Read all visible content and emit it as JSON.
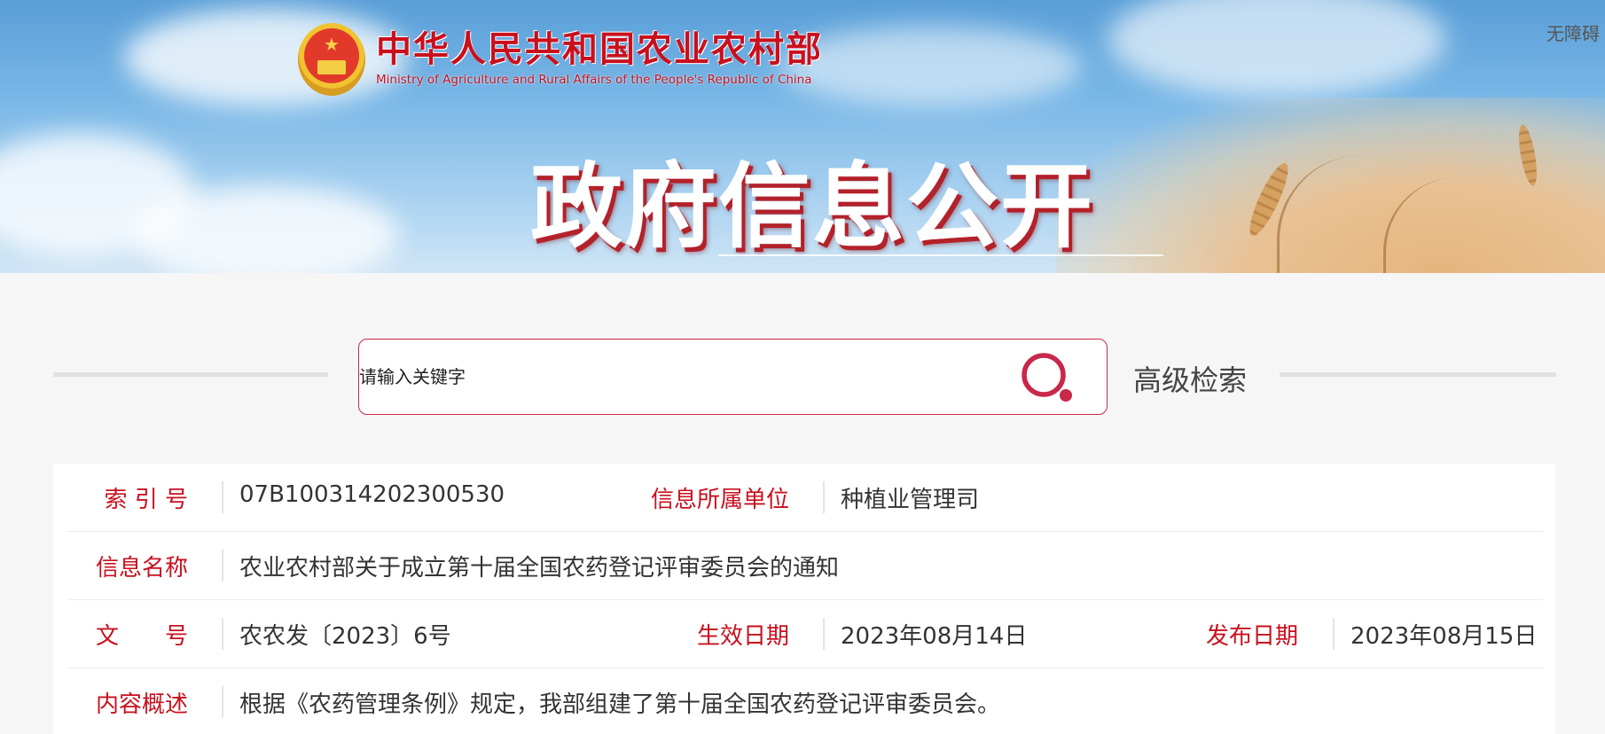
{
  "header": {
    "accessibility_label": "无障碍",
    "logo_cn": "中华人民共和国农业农村部",
    "logo_en": "Ministry of Agriculture and Rural Affairs of the People's Republic of China",
    "banner_title": "政府信息公开"
  },
  "search": {
    "placeholder": "请输入关键字",
    "advanced_label": "高级检索"
  },
  "info": {
    "index_label": "索 引 号",
    "index_value": "07B100314202300530",
    "unit_label": "信息所属单位",
    "unit_value": "种植业管理司",
    "name_label": "信息名称",
    "name_value": "农业农村部关于成立第十届全国农药登记评审委员会的通知",
    "docno_label": "文　　号",
    "docno_value": "农农发〔2023〕6号",
    "effective_label": "生效日期",
    "effective_value": "2023年08月14日",
    "publish_label": "发布日期",
    "publish_value": "2023年08月15日",
    "summary_label": "内容概述",
    "summary_value": "根据《农药管理条例》规定，我部组建了第十届全国农药登记评审委员会。"
  },
  "colors": {
    "accent_red": "#c8101e",
    "search_border": "#c8284a"
  }
}
